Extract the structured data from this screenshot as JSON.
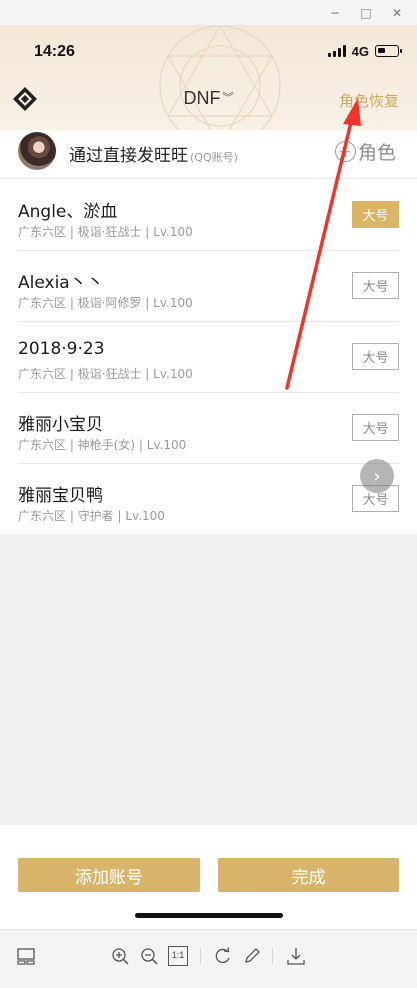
{
  "window": {
    "minimize_glyph": "−",
    "maximize_glyph": "□",
    "close_glyph": "✕"
  },
  "status_bar": {
    "time": "14:26",
    "network": "4G",
    "battery_level": 0.4
  },
  "header": {
    "game": "DNF",
    "game_chevron": "︾",
    "restore_label": "角色恢复"
  },
  "account": {
    "name": "通过直接发旺旺",
    "type": "(QQ账号)",
    "add_role_label": "角色"
  },
  "characters": [
    {
      "name": "Angle、淤血",
      "meta": "广东六区 | 极诣·狂战士 | Lv.100",
      "tag": "大号",
      "active": true
    },
    {
      "name": "Alexia丶丶",
      "meta": "广东六区 | 极诣·阿修罗 | Lv.100",
      "tag": "大号",
      "active": false
    },
    {
      "name": "2018·9·23",
      "meta": "广东六区 | 极诣·狂战士 | Lv.100",
      "tag": "大号",
      "active": false
    },
    {
      "name": "雅丽小宝贝",
      "meta": "广东六区 | 神枪手(女) | Lv.100",
      "tag": "大号",
      "active": false
    },
    {
      "name": "雅丽宝贝鸭",
      "meta": "广东六区 | 守护者 | Lv.100",
      "tag": "大号",
      "active": false
    }
  ],
  "float_button": {
    "glyph": "›"
  },
  "actions": {
    "add_account": "添加账号",
    "done": "完成"
  },
  "viewer_toolbar": {
    "fit_label": "1:1"
  },
  "colors": {
    "gold": "#d8b56b",
    "annotation_red": "#f0332b"
  }
}
